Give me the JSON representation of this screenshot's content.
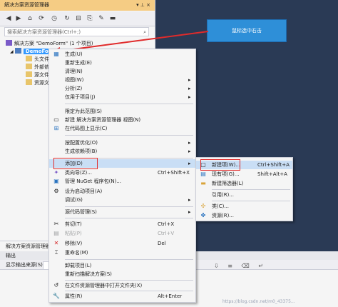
{
  "solution_explorer": {
    "title": "解决方案资源管理器",
    "pin": "▾ ⊥ ×",
    "search_placeholder": "搜索解决方案资源管理器(Ctrl+;)",
    "tree": {
      "solution": "解决方案 \"DemoForm\" (1 个项目)",
      "project": "DemoForm",
      "children": [
        "头文件",
        "外部依",
        "源文件",
        "资源文"
      ]
    },
    "footer": "解决方案资源管理器"
  },
  "callout": {
    "text": "鼠标选中右击"
  },
  "context_menu": {
    "items": [
      {
        "label": "生成(U)",
        "icon": "build-icon"
      },
      {
        "label": "重新生成(E)"
      },
      {
        "label": "清理(N)"
      },
      {
        "label": "视图(W)",
        "arrow": "▸"
      },
      {
        "label": "分析(Z)",
        "arrow": "▸"
      },
      {
        "label": "仅用于项目(J)",
        "arrow": "▸"
      },
      {
        "label": "限定为此范围(S)"
      },
      {
        "label": "新建 解决方案资源管理器 视图(N)",
        "icon": "new-view-icon"
      },
      {
        "label": "在代码图上显示(C)",
        "icon": "code-map-icon"
      },
      {
        "label": "按配置优化(O)",
        "arrow": "▸"
      },
      {
        "label": "生成依赖项(B)",
        "arrow": "▸"
      },
      {
        "label": "添加(D)",
        "arrow": "▸"
      },
      {
        "label": "类向导(Z)...",
        "shortcut": "Ctrl+Shift+X",
        "icon": "class-wizard-icon"
      },
      {
        "label": "管理 NuGet 程序包(N)...",
        "icon": "nuget-icon"
      },
      {
        "label": "设为启动项目(A)",
        "icon": "gear-icon"
      },
      {
        "label": "调试(G)",
        "arrow": "▸"
      },
      {
        "label": "源代码管理(S)",
        "arrow": "▸"
      },
      {
        "label": "剪切(T)",
        "shortcut": "Ctrl+X",
        "icon": "cut-icon"
      },
      {
        "label": "粘贴(P)",
        "shortcut": "Ctrl+V",
        "icon": "paste-icon"
      },
      {
        "label": "移除(V)",
        "shortcut": "Del",
        "icon": "remove-icon"
      },
      {
        "label": "重命名(M)",
        "icon": "rename-icon"
      },
      {
        "label": "卸载项目(L)"
      },
      {
        "label": "重新扫描解决方案(S)"
      },
      {
        "label": "在文件资源管理器中打开文件夹(X)",
        "icon": "folder-icon"
      },
      {
        "label": "属性(R)",
        "shortcut": "Alt+Enter",
        "icon": "wrench-icon"
      }
    ]
  },
  "submenu": {
    "items": [
      {
        "label": "新建项(W)...",
        "shortcut": "Ctrl+Shift+A"
      },
      {
        "label": "现有项(G)...",
        "shortcut": "Shift+Alt+A"
      },
      {
        "label": "新建筛选器(L)"
      },
      {
        "label": "引用(R)..."
      },
      {
        "label": "类(C)..."
      },
      {
        "label": "资源(R)..."
      }
    ]
  },
  "output": {
    "title": "输出",
    "source_label": "显示输出来源(S):"
  },
  "watermark": "https://blog.csdn.net/m0_43375..."
}
